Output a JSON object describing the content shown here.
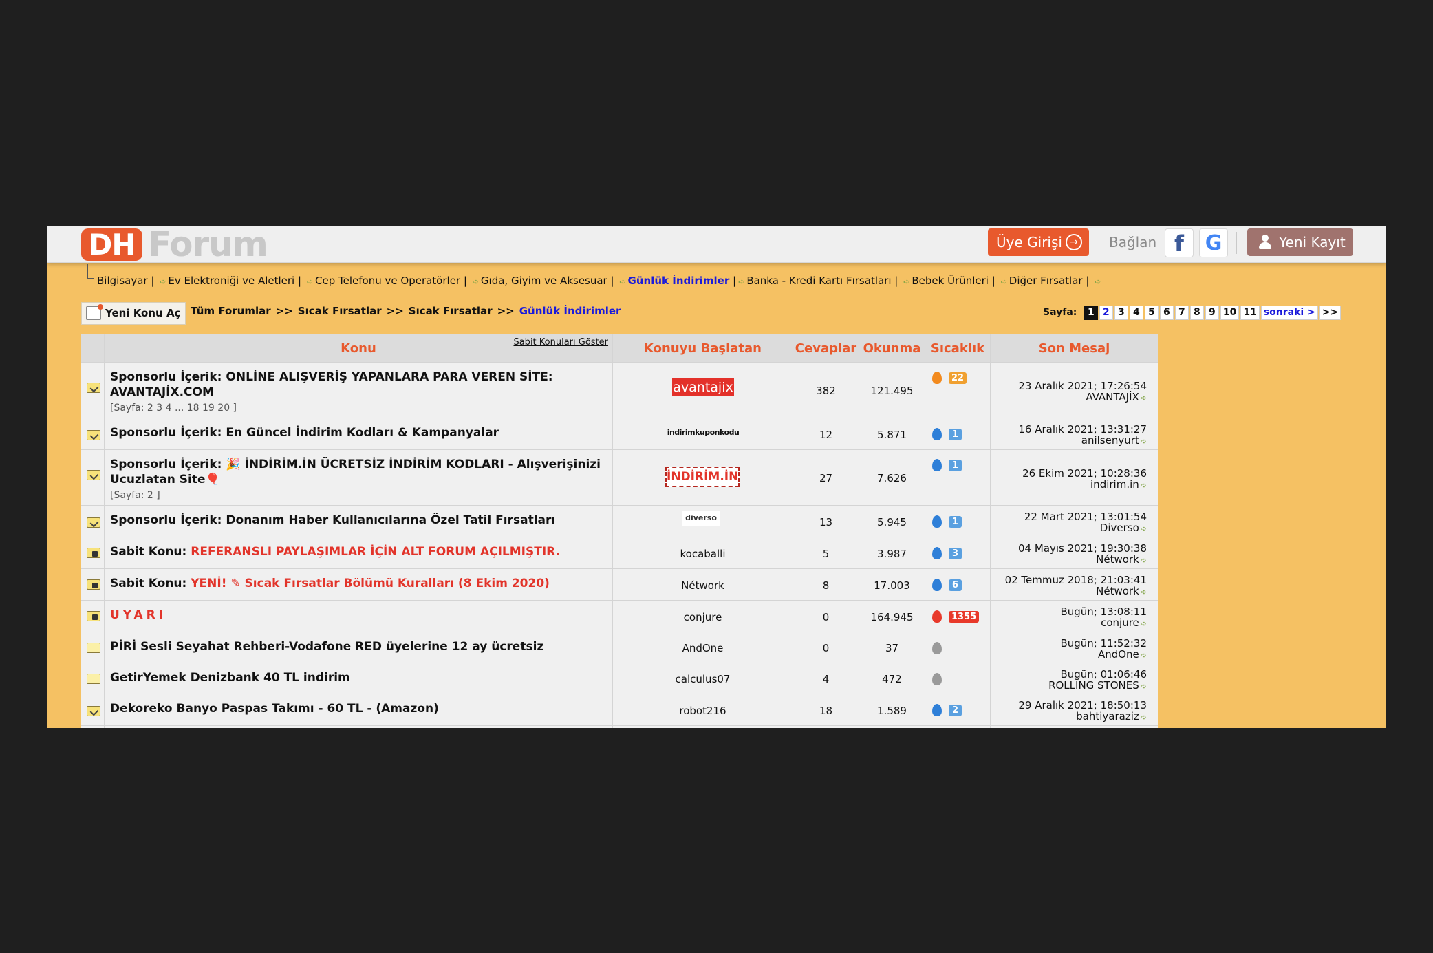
{
  "header": {
    "logo_dh": "DH",
    "logo_forum": "Forum",
    "login_label": "Üye Girişi",
    "connect_label": "Bağlan",
    "facebook_glyph": "f",
    "google_glyph": "G",
    "register_label": "Yeni Kayıt",
    "colors": {
      "accent": "#e8592d",
      "page_bg": "#f5c163",
      "register": "#a0736e",
      "link_active": "#1a1adb"
    }
  },
  "categories": [
    {
      "label": "Bilgisayar",
      "active": false
    },
    {
      "label": "Ev Elektroniği ve Aletleri",
      "active": false
    },
    {
      "label": "Cep Telefonu ve Operatörler",
      "active": false
    },
    {
      "label": "Gıda, Giyim ve Aksesuar",
      "active": false
    },
    {
      "label": "Günlük İndirimler",
      "active": true
    },
    {
      "label": "Banka - Kredi Kartı Fırsatları",
      "active": false
    },
    {
      "label": "Bebek Ürünleri",
      "active": false
    },
    {
      "label": "Diğer Fırsatlar",
      "active": false
    }
  ],
  "toolbar": {
    "new_topic_label": "Yeni Konu Aç",
    "breadcrumb": [
      "Tüm Forumlar",
      "Sıcak Fırsatlar",
      "Sıcak Fırsatlar",
      "Günlük İndirimler"
    ],
    "breadcrumb_sep": ">>",
    "pages_label": "Sayfa:",
    "pages": [
      "1",
      "2",
      "3",
      "4",
      "5",
      "6",
      "7",
      "8",
      "9",
      "10",
      "11"
    ],
    "current_page": "1",
    "next_label": "sonraki >",
    "last_label": ">>"
  },
  "table": {
    "headers": {
      "topic": "Konu",
      "show_sticky": "Sabit Konuları Göster",
      "starter": "Konuyu Başlatan",
      "replies": "Cevaplar",
      "views": "Okunma",
      "heat": "Sıcaklık",
      "last_post": "Son Mesaj"
    },
    "rows": [
      {
        "icon": "folder-new-icon",
        "prefix": "Sponsorlu İçerik:",
        "title": "ONLİNE ALIŞVERİŞ YAPANLARA PARA VEREN SİTE: AVANTAJİX.COM",
        "pages": "[Sayfa: 2 3 4 ... 18 19 20 ]",
        "starter": "avantajix",
        "starter_logo": "avantajix",
        "replies": "382",
        "views": "121.495",
        "heat": "22",
        "heat_color": "orange",
        "last_date": "23 Aralık 2021; 17:26:54",
        "last_user": "AVANTAJİX"
      },
      {
        "icon": "folder-new-icon",
        "prefix": "Sponsorlu İçerik:",
        "title": "En Güncel İndirim Kodları & Kampanyalar",
        "pages": "",
        "starter": "indirimkuponkodu",
        "starter_logo": "kupon",
        "replies": "12",
        "views": "5.871",
        "heat": "1",
        "heat_color": "blue",
        "last_date": "16 Aralık 2021; 13:31:27",
        "last_user": "anilsenyurt"
      },
      {
        "icon": "folder-new-icon",
        "prefix": "Sponsorlu İçerik:",
        "title": "🎉 İNDİRİM.İN ÜCRETSİZ İNDİRİM KODLARI - Alışverişinizi Ucuzlatan Site🎈",
        "pages": "[Sayfa: 2 ]",
        "starter": "İNDİRİM.İN",
        "starter_logo": "indirim",
        "replies": "27",
        "views": "7.626",
        "heat": "1",
        "heat_color": "blue",
        "last_date": "26 Ekim 2021; 10:28:36",
        "last_user": "indirim.in"
      },
      {
        "icon": "folder-new-icon",
        "prefix": "Sponsorlu İçerik:",
        "title": "Donanım Haber Kullanıcılarına Özel Tatil Fırsatları",
        "pages": "",
        "starter": "diverso",
        "starter_logo": "diverso",
        "replies": "13",
        "views": "5.945",
        "heat": "1",
        "heat_color": "blue",
        "last_date": "22 Mart 2021; 13:01:54",
        "last_user": "Diverso"
      },
      {
        "icon": "folder-lock-icon",
        "prefix": "Sabit Konu:",
        "title": "REFERANSLI PAYLAŞIMLAR İÇİN ALT FORUM AÇILMIŞTIR.",
        "red": true,
        "pages": "",
        "starter": "kocaballi",
        "starter_logo": "",
        "replies": "5",
        "views": "3.987",
        "heat": "3",
        "heat_color": "blue",
        "last_date": "04 Mayıs 2021; 19:30:38",
        "last_user": "Nétwork"
      },
      {
        "icon": "folder-lock-icon",
        "prefix": "Sabit Konu:",
        "title": "YENİ! ✎ Sıcak Fırsatlar Bölümü Kuralları (8 Ekim 2020)",
        "red": true,
        "pages": "",
        "starter": "Nétwork",
        "starter_logo": "",
        "replies": "8",
        "views": "17.003",
        "heat": "6",
        "heat_color": "blue",
        "last_date": "02 Temmuz 2018; 21:03:41",
        "last_user": "Nétwork"
      },
      {
        "icon": "folder-lock-icon",
        "prefix": "",
        "title": "UYARI",
        "spaced": true,
        "pages": "",
        "starter": "conjure",
        "starter_logo": "",
        "replies": "0",
        "views": "164.945",
        "heat": "1355",
        "heat_color": "red",
        "last_date": "Bugün; 13:08:11",
        "last_user": "conjure"
      },
      {
        "icon": "folder-icon",
        "prefix": "",
        "title": "PİRİ Sesli Seyahat Rehberi-Vodafone RED üyelerine 12 ay ücretsiz",
        "pages": "",
        "starter": "AndOne",
        "starter_logo": "",
        "replies": "0",
        "views": "37",
        "heat": "",
        "heat_color": "grey",
        "last_date": "Bugün; 11:52:32",
        "last_user": "AndOne"
      },
      {
        "icon": "folder-icon",
        "prefix": "",
        "title": "GetirYemek Denizbank 40 TL indirim",
        "pages": "",
        "starter": "calculus07",
        "starter_logo": "",
        "replies": "4",
        "views": "472",
        "heat": "",
        "heat_color": "grey",
        "last_date": "Bugün; 01:06:46",
        "last_user": "ROLLING STONES"
      },
      {
        "icon": "folder-new-icon",
        "prefix": "",
        "title": "Dekoreko Banyo Paspas Takımı - 60 TL - (Amazon)",
        "pages": "",
        "starter": "robot216",
        "starter_logo": "",
        "replies": "18",
        "views": "1.589",
        "heat": "2",
        "heat_color": "blue",
        "last_date": "29 Aralık 2021; 18:50:13",
        "last_user": "bahtiyaraziz"
      }
    ]
  }
}
